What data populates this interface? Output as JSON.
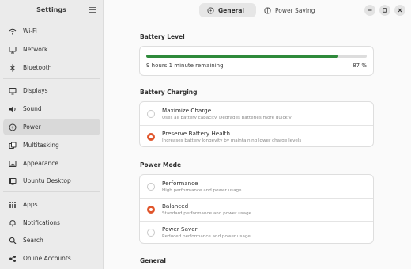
{
  "sidebar": {
    "title": "Settings",
    "items": [
      {
        "label": "Wi-Fi",
        "icon": "wifi-icon"
      },
      {
        "label": "Network",
        "icon": "network-icon"
      },
      {
        "label": "Bluetooth",
        "icon": "bluetooth-icon"
      },
      {
        "label": "Displays",
        "icon": "display-icon"
      },
      {
        "label": "Sound",
        "icon": "speaker-icon"
      },
      {
        "label": "Power",
        "icon": "power-icon"
      },
      {
        "label": "Multitasking",
        "icon": "multitasking-icon"
      },
      {
        "label": "Appearance",
        "icon": "appearance-icon"
      },
      {
        "label": "Ubuntu Desktop",
        "icon": "ubuntu-desktop-icon"
      },
      {
        "label": "Apps",
        "icon": "apps-icon"
      },
      {
        "label": "Notifications",
        "icon": "bell-icon"
      },
      {
        "label": "Search",
        "icon": "search-icon"
      },
      {
        "label": "Online Accounts",
        "icon": "online-accounts-icon"
      }
    ]
  },
  "tabs": [
    {
      "label": "General",
      "icon": "general-icon"
    },
    {
      "label": "Power Saving",
      "icon": "power-saving-icon"
    }
  ],
  "battery_level": {
    "title": "Battery Level",
    "remaining": "9 hours 1 minute remaining",
    "percent_label": "87 %",
    "level_fraction": 0.87,
    "bar_color": "#2e8a3b"
  },
  "battery_charging": {
    "title": "Battery Charging",
    "options": [
      {
        "title": "Maximize Charge",
        "subtitle": "Uses all battery capacity. Degrades batteries more quickly",
        "selected": false
      },
      {
        "title": "Preserve Battery Health",
        "subtitle": "Increases battery longevity by maintaining lower charge levels",
        "selected": true
      }
    ]
  },
  "power_mode": {
    "title": "Power Mode",
    "options": [
      {
        "title": "Performance",
        "subtitle": "High performance and power usage",
        "selected": false
      },
      {
        "title": "Balanced",
        "subtitle": "Standard performance and power usage",
        "selected": true
      },
      {
        "title": "Power Saver",
        "subtitle": "Reduced performance and power usage",
        "selected": false
      }
    ]
  },
  "general_section": {
    "title": "General"
  },
  "colors": {
    "accent": "#e0552b",
    "active_nav_bg": "#d9d9d9"
  }
}
